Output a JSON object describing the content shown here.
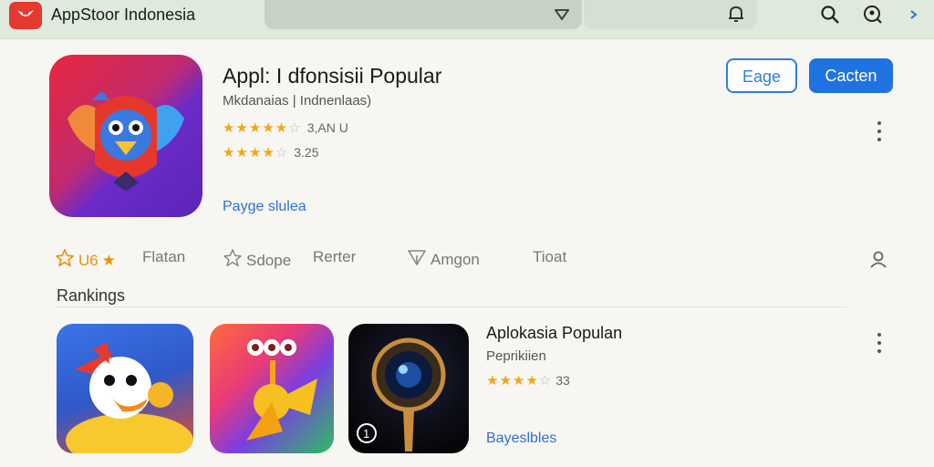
{
  "header": {
    "app_title": "AppStoor Indonesia",
    "icons": [
      "logo-icon",
      "dropdown-chevron-icon",
      "bell-icon",
      "search-icon",
      "account-search-icon",
      "forward-chevron-icon"
    ]
  },
  "hero": {
    "title": "Appl: I dfonsisii Popular",
    "subtitle": "Mkdanaias | Indnenlaas)",
    "rating_1": {
      "stars": 5,
      "label": "3,AN U"
    },
    "rating_2": {
      "stars": 4,
      "label": "3.25"
    },
    "link": "Payge slulea",
    "btn_outline": "Eage",
    "btn_primary": "Cacten"
  },
  "tabs": [
    {
      "label": "U6",
      "icon": "star-outline-icon",
      "active": true
    },
    {
      "label": "Flatan"
    },
    {
      "label": "Sdope",
      "icon": "star-outline-icon"
    },
    {
      "label": "Rerter"
    },
    {
      "label": "Amgon",
      "icon": "send-icon"
    },
    {
      "label": "Tioat"
    }
  ],
  "section": {
    "title": "Rankings"
  },
  "ranking_item": {
    "title": "Aplokasia Populan",
    "subtitle": "Peprikiien",
    "rating": {
      "stars": 4,
      "label": "33"
    },
    "link": "Bayeslbles",
    "tile_badge": "1"
  },
  "colors": {
    "topbar": "#dfe9dc",
    "accent_blue": "#1f73e0",
    "star": "#f2a516",
    "active_tab": "#e8940e"
  }
}
